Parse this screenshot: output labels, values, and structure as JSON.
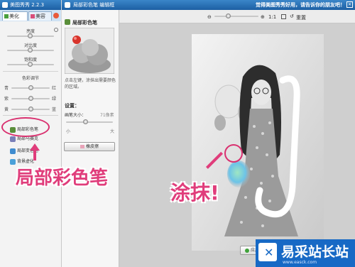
{
  "left_app": {
    "title": "美图秀秀 2.2.3",
    "tabs": [
      "美化",
      "美容"
    ],
    "sliders": [
      "亮度",
      "对比度",
      "饱和度"
    ],
    "color_adjust": {
      "title": "色彩调节",
      "rows": [
        {
          "left": "青",
          "right": "红",
          "value": 0.5
        },
        {
          "left": "紫",
          "right": "绿",
          "value": 0.5
        },
        {
          "left": "黄",
          "right": "蓝",
          "value": 0.5
        }
      ]
    },
    "tools": [
      "局部彩色笔",
      "局部马赛克",
      "局部变色笔",
      "背景虚化"
    ]
  },
  "right_app": {
    "title": "局部彩色笔 编辑框",
    "title_right": "觉得美图秀秀好用，请告诉你的朋友吧！",
    "panel": {
      "tool_name": "局部彩色笔",
      "instruction": "点击左键，涂抹出需要颜色的区域。",
      "settings_label": "设置：",
      "brush_label": "画笔大小：",
      "brush_value": "71像素",
      "size_small": "小",
      "size_large": "大",
      "eraser_label": "橡皮擦"
    },
    "toolbar": {
      "zoom": "1:1",
      "reset": "重置"
    },
    "apply_label": "应用"
  },
  "annotations": {
    "tool_caption": "局部彩色笔",
    "smear_caption": "涂抹!"
  },
  "watermark": {
    "site": "易采站长站",
    "url": "www.easck.com"
  }
}
